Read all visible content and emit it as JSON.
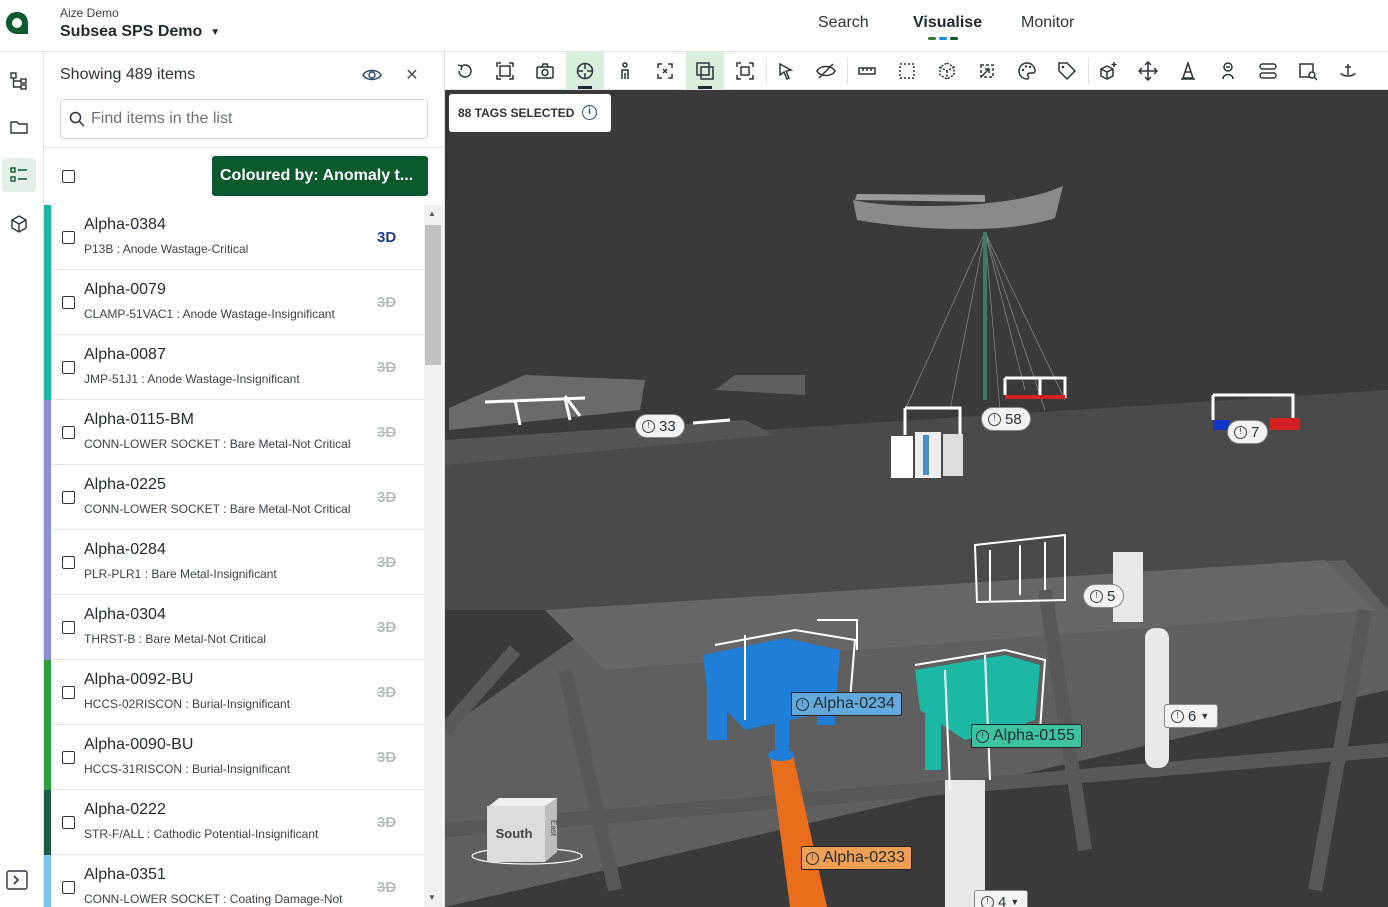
{
  "header": {
    "org": "Aize Demo",
    "project": "Subsea SPS Demo",
    "nav": [
      "Search",
      "Visualise",
      "Monitor"
    ],
    "active_nav": "Visualise",
    "accent_colors": [
      "#2e7d32",
      "#1e88e5",
      "#0b5a2e"
    ]
  },
  "rail": {
    "icons": [
      "hierarchy-icon",
      "folder-icon",
      "list-icon",
      "cube-icon"
    ],
    "active": "list-icon",
    "bottom_icon": "expand-panel-icon"
  },
  "panel": {
    "title": "Showing 489 items",
    "search_placeholder": "Find items in the list",
    "colour_button": "Coloured by: Anomaly t...",
    "items": [
      {
        "name": "Alpha-0384",
        "detail": "P13B : Anode Wastage-Critical",
        "badge": "3D",
        "active3d": true,
        "color": "#1db8a3"
      },
      {
        "name": "Alpha-0079",
        "detail": "CLAMP-51VAC1 : Anode Wastage-Insignificant",
        "badge": "3D",
        "active3d": false,
        "color": "#1db8a3"
      },
      {
        "name": "Alpha-0087",
        "detail": "JMP-51J1 : Anode Wastage-Insignificant",
        "badge": "3D",
        "active3d": false,
        "color": "#1db8a3"
      },
      {
        "name": "Alpha-0115-BM",
        "detail": "CONN-LOWER SOCKET : Bare Metal-Not Critical",
        "badge": "3D",
        "active3d": false,
        "color": "#8c8fd6"
      },
      {
        "name": "Alpha-0225",
        "detail": "CONN-LOWER SOCKET : Bare Metal-Not Critical",
        "badge": "3D",
        "active3d": false,
        "color": "#8c8fd6"
      },
      {
        "name": "Alpha-0284",
        "detail": "PLR-PLR1 : Bare Metal-Insignificant",
        "badge": "3D",
        "active3d": false,
        "color": "#8c8fd6"
      },
      {
        "name": "Alpha-0304",
        "detail": "THRST-B : Bare Metal-Not Critical",
        "badge": "3D",
        "active3d": false,
        "color": "#8c8fd6"
      },
      {
        "name": "Alpha-0092-BU",
        "detail": "HCCS-02RISCON : Burial-Insignificant",
        "badge": "3D",
        "active3d": false,
        "color": "#2ea043"
      },
      {
        "name": "Alpha-0090-BU",
        "detail": "HCCS-31RISCON : Burial-Insignificant",
        "badge": "3D",
        "active3d": false,
        "color": "#2ea043"
      },
      {
        "name": "Alpha-0222",
        "detail": "STR-F/ALL : Cathodic Potential-Insignificant",
        "badge": "3D",
        "active3d": false,
        "color": "#1a5e4a"
      },
      {
        "name": "Alpha-0351",
        "detail": "CONN-LOWER SOCKET : Coating Damage-Not",
        "badge": "3D",
        "active3d": false,
        "color": "#7cc4e8"
      }
    ]
  },
  "toolbar": {
    "tools": [
      "rotate-icon",
      "fit-view-icon",
      "camera-icon",
      "target-icon",
      "person-icon",
      "focus-icon",
      "layers-icon",
      "select-box-icon",
      "pointer-icon",
      "hide-icon",
      "ruler-icon",
      "area-select-icon",
      "cube-wire-icon",
      "clip-icon",
      "palette-icon",
      "tag-icon",
      "add-cube-icon",
      "move-icon",
      "cone-icon",
      "diver-icon",
      "route-icon",
      "inspect-icon",
      "anchor-icon"
    ],
    "active": [
      "target-icon",
      "layers-icon"
    ]
  },
  "viewport": {
    "selection_badge": "88 TAGS SELECTED",
    "clusters": [
      {
        "label": "33",
        "has_caret": false
      },
      {
        "label": "58",
        "has_caret": false
      },
      {
        "label": "7",
        "has_caret": false
      },
      {
        "label": "5",
        "has_caret": false
      },
      {
        "label": "6",
        "has_caret": true
      },
      {
        "label": "4",
        "has_caret": true
      }
    ],
    "tags": [
      {
        "label": "Alpha-0234",
        "color": "#63a9dc"
      },
      {
        "label": "Alpha-0155",
        "color": "#3ec3a2"
      },
      {
        "label": "Alpha-0233",
        "color": "#f0a055"
      }
    ],
    "nav_cube": {
      "front": "South",
      "side": "East"
    }
  }
}
